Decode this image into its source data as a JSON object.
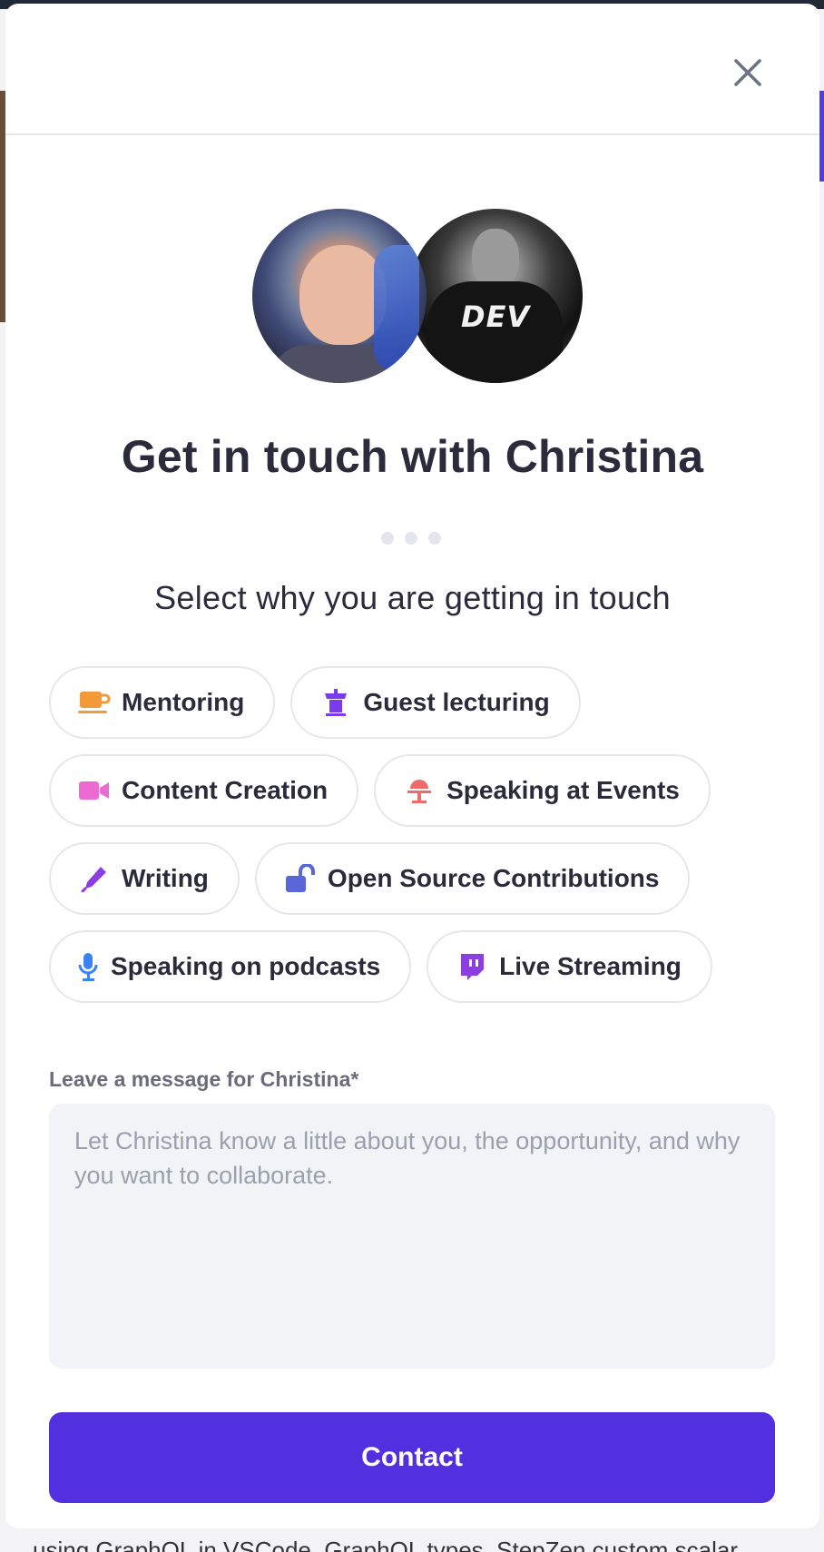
{
  "modal": {
    "close_icon": "close-icon",
    "title": "Get in touch with Christina",
    "steps_total": 3,
    "subtitle": "Select why you are getting in touch",
    "reasons": [
      {
        "label": "Mentoring",
        "icon": "coffee-cup-icon",
        "color": "#f29a38"
      },
      {
        "label": "Guest lecturing",
        "icon": "lectern-icon",
        "color": "#7c3aed"
      },
      {
        "label": "Content Creation",
        "icon": "video-camera-icon",
        "color": "#ec6bd2"
      },
      {
        "label": "Speaking at Events",
        "icon": "podium-icon",
        "color": "#ee6b6b"
      },
      {
        "label": "Writing",
        "icon": "pen-icon",
        "color": "#8b3fe0"
      },
      {
        "label": "Open Source Contributions",
        "icon": "unlock-icon",
        "color": "#5a67d8"
      },
      {
        "label": "Speaking on podcasts",
        "icon": "microphone-icon",
        "color": "#3b82f6"
      },
      {
        "label": "Live Streaming",
        "icon": "twitch-icon",
        "color": "#8b3fe0"
      }
    ],
    "message_label": "Leave a message for Christina*",
    "message_placeholder": "Let Christina know a little about you, the opportunity, and why you want to collaborate.",
    "message_value": "",
    "contact_label": "Contact",
    "accent_color": "#5230e0"
  },
  "background": {
    "bottom_text": "using GraphQL in VSCode. GraphQL types. StepZen custom scalar"
  }
}
